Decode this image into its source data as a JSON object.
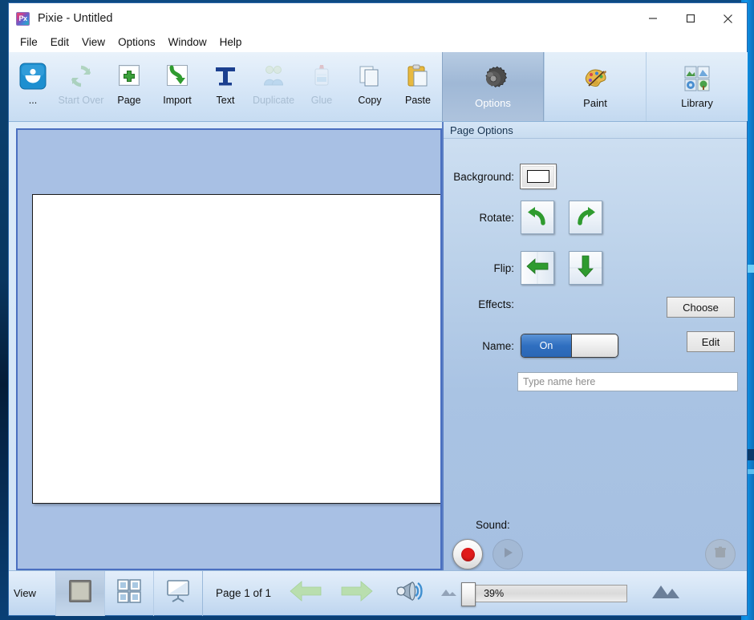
{
  "window": {
    "title": "Pixie - Untitled",
    "app_icon": "pixie-app-icon",
    "icon_text": "Px",
    "controls": {
      "minimize": "minimize-icon",
      "maximize": "maximize-icon",
      "close": "close-icon"
    }
  },
  "menu": {
    "items": [
      {
        "label": "File"
      },
      {
        "label": "Edit"
      },
      {
        "label": "View"
      },
      {
        "label": "Options"
      },
      {
        "label": "Window"
      },
      {
        "label": "Help"
      }
    ]
  },
  "toolbar": {
    "left_buttons": [
      {
        "label": "...",
        "icon": "more-smiley-icon",
        "enabled": true
      },
      {
        "label": "Start Over",
        "icon": "refresh-icon",
        "enabled": false
      },
      {
        "label": "Page",
        "icon": "page-plus-icon",
        "enabled": true
      },
      {
        "label": "Import",
        "icon": "import-arrow-icon",
        "enabled": true
      },
      {
        "label": "Text",
        "icon": "text-t-icon",
        "enabled": true
      },
      {
        "label": "Duplicate",
        "icon": "duplicate-icon",
        "enabled": false
      },
      {
        "label": "Glue",
        "icon": "glue-bottle-icon",
        "enabled": false
      },
      {
        "label": "Copy",
        "icon": "copy-pages-icon",
        "enabled": true
      },
      {
        "label": "Paste",
        "icon": "paste-clipboard-icon",
        "enabled": true
      }
    ],
    "tabs": [
      {
        "label": "Options",
        "icon": "gear-icon",
        "selected": true
      },
      {
        "label": "Paint",
        "icon": "palette-icon",
        "selected": false
      },
      {
        "label": "Library",
        "icon": "library-grid-icon",
        "selected": false
      }
    ]
  },
  "panel": {
    "header": "Page Options",
    "background": {
      "label": "Background:",
      "swatch_color": "#ffffff",
      "icon": "color-swatch-icon"
    },
    "rotate": {
      "label": "Rotate:",
      "left_icon": "rotate-left-icon",
      "right_icon": "rotate-right-icon"
    },
    "flip": {
      "label": "Flip:",
      "horizontal_icon": "flip-horizontal-icon",
      "vertical_icon": "flip-vertical-icon"
    },
    "effects": {
      "label": "Effects:",
      "button": "Choose"
    },
    "name": {
      "label": "Name:",
      "toggle_state": "On",
      "edit_button": "Edit",
      "input_placeholder": "Type name here",
      "input_value": ""
    },
    "sound": {
      "label": "Sound:",
      "record_icon": "record-icon",
      "play_icon": "play-icon",
      "delete_icon": "trash-icon",
      "play_enabled": false,
      "delete_enabled": false
    }
  },
  "status": {
    "view_label": "View",
    "view_modes": [
      {
        "icon": "single-page-view-icon",
        "selected": true
      },
      {
        "icon": "grid-view-icon",
        "selected": false
      },
      {
        "icon": "presentation-view-icon",
        "selected": false
      }
    ],
    "page_indicator": "Page 1 of 1",
    "prev_icon": "arrow-left-icon",
    "next_icon": "arrow-right-icon",
    "speaker_icon": "megaphone-icon",
    "zoom": {
      "small_icon": "small-mountain-icon",
      "large_icon": "large-mountain-icon",
      "percent": "39%",
      "value": 39
    }
  },
  "colors": {
    "accent": "#2f6fc0",
    "panel": "#a9c3e3",
    "canvas_bg": "#a8c0e4",
    "page": "#ffffff",
    "record_red": "#e01b1b",
    "green": "#2aa22a"
  }
}
